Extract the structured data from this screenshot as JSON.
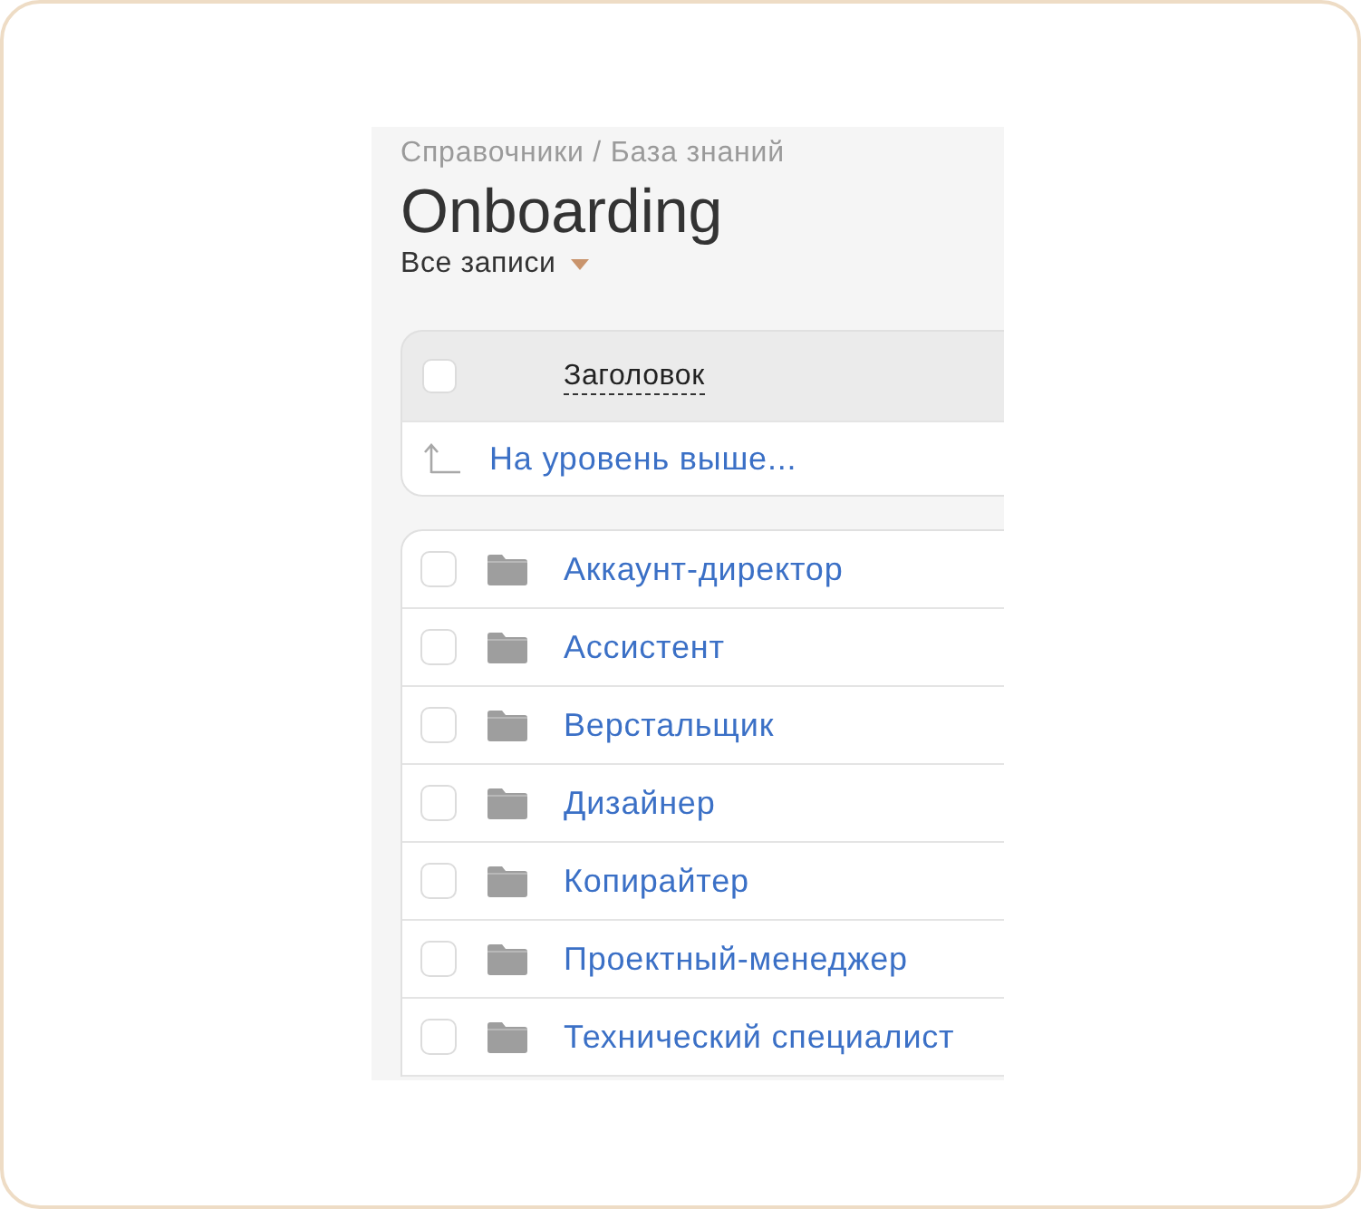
{
  "breadcrumb": "Справочники / База знаний",
  "title": "Onboarding",
  "filter": {
    "label": "Все записи"
  },
  "table": {
    "header": {
      "checked": false,
      "column": "Заголовок"
    },
    "up_link": "На уровень выше...",
    "rows": [
      {
        "title": "Аккаунт-директор",
        "checked": false
      },
      {
        "title": "Ассистент",
        "checked": false
      },
      {
        "title": "Верстальщик",
        "checked": false
      },
      {
        "title": "Дизайнер",
        "checked": false
      },
      {
        "title": "Копирайтер",
        "checked": false
      },
      {
        "title": "Проектный-менеджер",
        "checked": false
      },
      {
        "title": "Технический специалист",
        "checked": false
      }
    ]
  }
}
